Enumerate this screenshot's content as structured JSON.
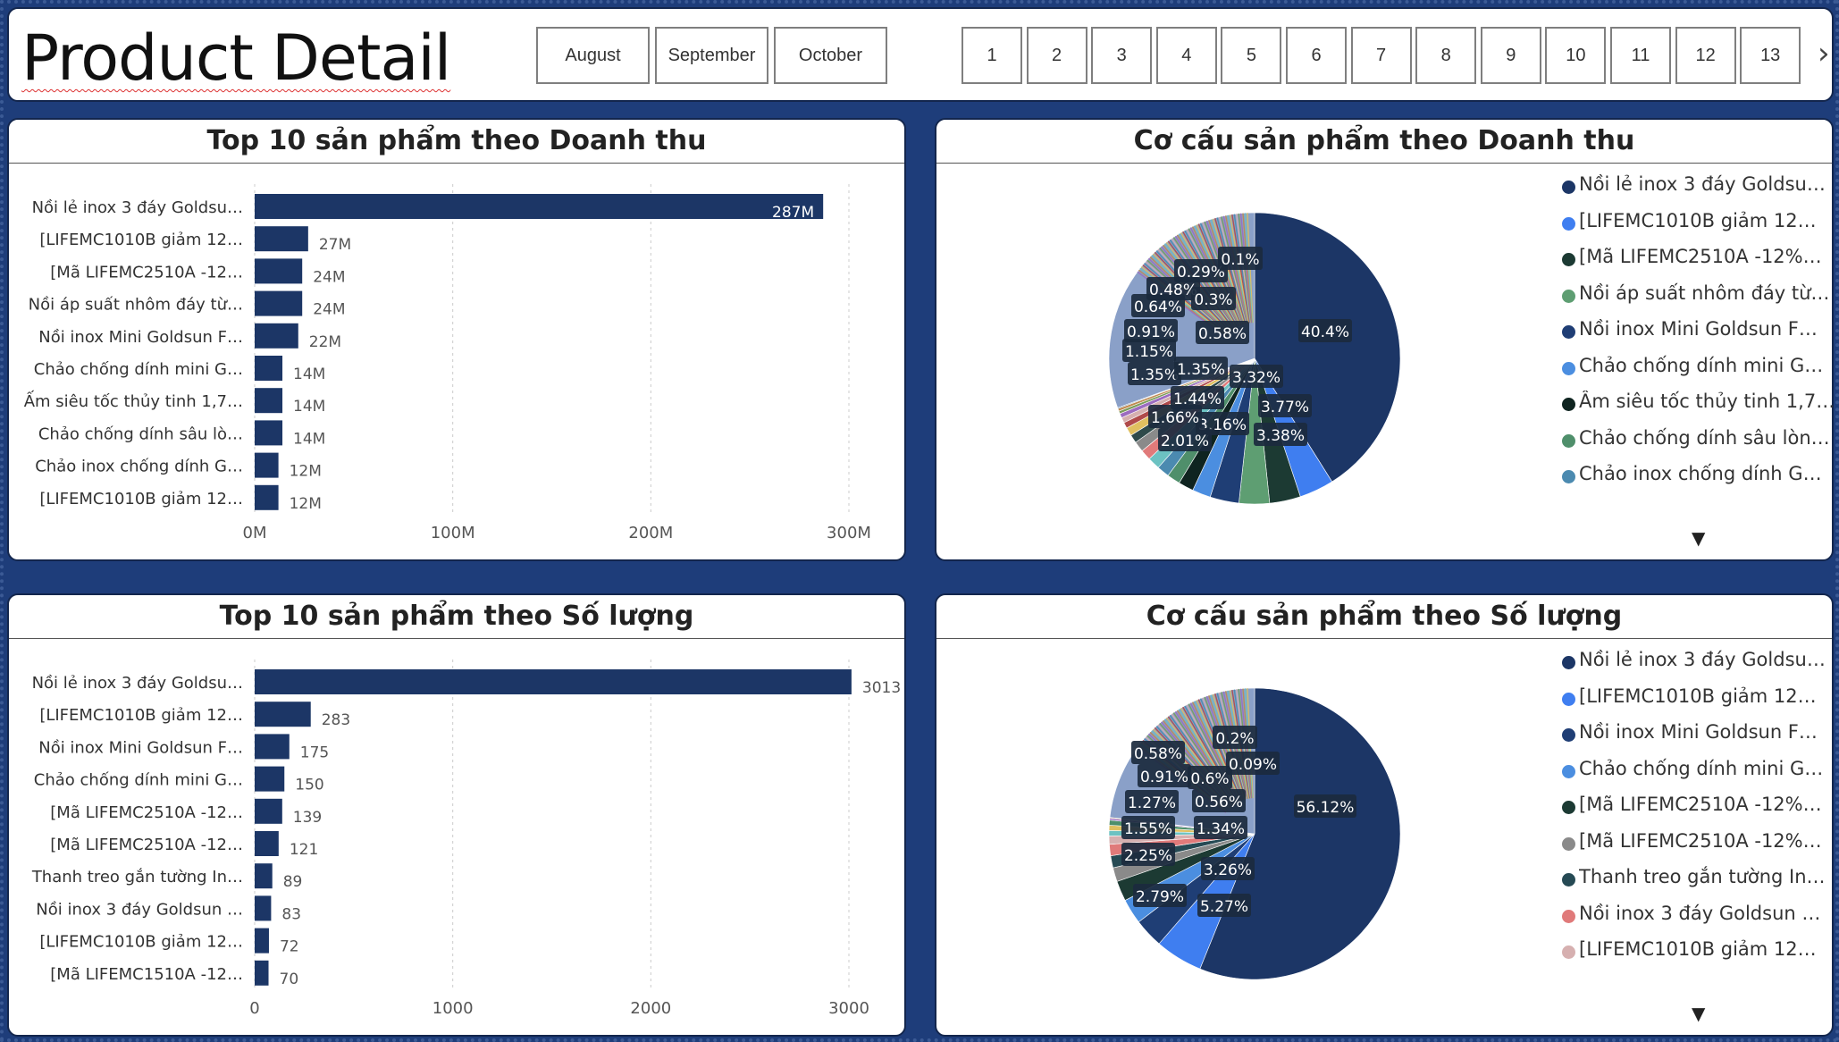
{
  "header": {
    "title": "Product Detail",
    "months": [
      "August",
      "September",
      "October"
    ],
    "days": [
      "1",
      "2",
      "3",
      "4",
      "5",
      "6",
      "7",
      "8",
      "9",
      "10",
      "11",
      "12",
      "13"
    ],
    "next_icon": "chevron-right-icon"
  },
  "colors": {
    "background": "#1e3d7a",
    "bar": "#1c3666",
    "panel_border": "#13264d"
  },
  "revenue_bar": {
    "title": "Top 10 sản phẩm theo Doanh thu",
    "chart_data": {
      "type": "bar",
      "orientation": "horizontal",
      "categories": [
        "Nồi lẻ inox 3 đáy Goldsu…",
        "[LIFEMC1010B giảm 12…",
        "[Mã LIFEMC2510A -12…",
        "Nồi áp suất nhôm đáy từ…",
        "Nồi inox Mini Goldsun F…",
        "Chảo chống dính mini G…",
        "Ấm siêu tốc thủy tinh 1,7…",
        "Chảo chống dính sâu lò…",
        "Chảo inox chống dính G…",
        "[LIFEMC1010B giảm 12…"
      ],
      "values": [
        287,
        27,
        24,
        24,
        22,
        14,
        14,
        14,
        12,
        12
      ],
      "value_labels": [
        "287M",
        "27M",
        "24M",
        "24M",
        "22M",
        "14M",
        "14M",
        "14M",
        "12M",
        "12M"
      ],
      "xticks": [
        "0M",
        "100M",
        "200M",
        "300M"
      ],
      "xlim": [
        0,
        300
      ],
      "grid": true
    }
  },
  "revenue_pie": {
    "title": "Cơ cấu sản phẩm theo Doanh thu",
    "chart_data": {
      "type": "pie",
      "slices": [
        {
          "label": "Nồi lẻ inox 3 đáy Goldsu…",
          "value": 40.4,
          "color": "#1c3666",
          "text": "40.4%"
        },
        {
          "label": "[LIFEMC1010B giảm 12…",
          "value": 3.77,
          "color": "#3f7ef0",
          "text": "3.77%"
        },
        {
          "label": "[Mã LIFEMC2510A -12%…",
          "value": 3.38,
          "color": "#1c3a33",
          "text": "3.38%"
        },
        {
          "label": "Nồi áp suất nhôm đáy từ…",
          "value": 3.32,
          "color": "#5e9e72",
          "text": "3.32%"
        },
        {
          "label": "Nồi inox Mini Goldsun F…",
          "value": 3.16,
          "color": "#1f3e75",
          "text": "3.16%"
        },
        {
          "label": "Chảo chống dính mini G…",
          "value": 2.01,
          "color": "#4b8ee0",
          "text": "2.01%"
        },
        {
          "label": "Ấm siêu tốc thủy tinh 1,7…",
          "value": 1.66,
          "color": "#0f2420",
          "text": "1.66%"
        },
        {
          "label": "Chảo chống dính sâu lòn…",
          "value": 1.44,
          "color": "#4f8f6b",
          "text": "1.44%"
        },
        {
          "label": "Chảo inox chống dính G…",
          "value": 1.35,
          "color": "#4b8ab0",
          "text": "1.35%"
        },
        {
          "label": "",
          "value": 1.35,
          "color": "#6cc2c2",
          "text": "1.35%"
        },
        {
          "label": "",
          "value": 1.15,
          "color": "#e07a7a",
          "text": "1.15%"
        },
        {
          "label": "",
          "value": 1.15,
          "color": "#8a8a8a",
          "text": "1.15%"
        },
        {
          "label": "",
          "value": 0.91,
          "color": "#2e4a4a",
          "text": "0.91%"
        },
        {
          "label": "",
          "value": 0.91,
          "color": "#e0c060",
          "text": "0.91%"
        },
        {
          "label": "",
          "value": 0.64,
          "color": "#b04a4a",
          "text": "0.64%"
        },
        {
          "label": "",
          "value": 0.58,
          "color": "#d6b0b0",
          "text": "0.58%"
        },
        {
          "label": "",
          "value": 0.48,
          "color": "#9c6cc0",
          "text": "0.48%"
        },
        {
          "label": "",
          "value": 0.3,
          "color": "#7a9c5a",
          "text": "0.3%"
        },
        {
          "label": "",
          "value": 0.29,
          "color": "#c08a50",
          "text": "0.29%"
        },
        {
          "label": "",
          "value": 0.1,
          "color": "#3a6a9a",
          "text": "0.1%"
        },
        {
          "label": "",
          "value": 30.0,
          "color": "#8aa0c8",
          "text": ""
        }
      ]
    }
  },
  "qty_bar": {
    "title": "Top 10 sản phẩm theo Số lượng",
    "chart_data": {
      "type": "bar",
      "orientation": "horizontal",
      "categories": [
        "Nồi lẻ inox 3 đáy Goldsu…",
        "[LIFEMC1010B giảm 12…",
        "Nồi inox Mini Goldsun F…",
        "Chảo chống dính mini G…",
        "[Mã LIFEMC2510A -12…",
        "[Mã LIFEMC2510A -12…",
        "Thanh treo gắn tường In…",
        "Nồi inox 3 đáy Goldsun …",
        "[LIFEMC1010B giảm 12…",
        "[Mã LIFEMC1510A -12…"
      ],
      "values": [
        3013,
        283,
        175,
        150,
        139,
        121,
        89,
        83,
        72,
        70
      ],
      "value_labels": [
        "3013",
        "283",
        "175",
        "150",
        "139",
        "121",
        "89",
        "83",
        "72",
        "70"
      ],
      "xticks": [
        "0",
        "1000",
        "2000",
        "3000"
      ],
      "xlim": [
        0,
        3000
      ],
      "grid": true
    }
  },
  "qty_pie": {
    "title": "Cơ cấu sản phẩm theo Số lượng",
    "chart_data": {
      "type": "pie",
      "slices": [
        {
          "label": "Nồi lẻ inox 3 đáy Goldsu…",
          "value": 56.12,
          "color": "#1c3666",
          "text": "56.12%"
        },
        {
          "label": "[LIFEMC1010B giảm 12…",
          "value": 5.27,
          "color": "#3f7ef0",
          "text": "5.27%"
        },
        {
          "label": "Nồi inox Mini Goldsun F…",
          "value": 3.26,
          "color": "#1f3e75",
          "text": "3.26%"
        },
        {
          "label": "Chảo chống dính mini G…",
          "value": 2.79,
          "color": "#4b8ee0",
          "text": "2.79%"
        },
        {
          "label": "[Mã LIFEMC2510A -12%…",
          "value": 2.25,
          "color": "#1c3a33",
          "text": "2.25%"
        },
        {
          "label": "[Mã LIFEMC2510A -12%…",
          "value": 1.55,
          "color": "#8a8a8a",
          "text": "1.55%"
        },
        {
          "label": "Thanh treo gắn tường In…",
          "value": 1.34,
          "color": "#264a54",
          "text": "1.34%"
        },
        {
          "label": "Nồi inox 3 đáy Goldsun …",
          "value": 1.27,
          "color": "#e07a7a",
          "text": "1.27%"
        },
        {
          "label": "[LIFEMC1010B giảm 12…",
          "value": 0.91,
          "color": "#d6b0b0",
          "text": "0.91%"
        },
        {
          "label": "",
          "value": 0.6,
          "color": "#6cc2c2",
          "text": "0.6%"
        },
        {
          "label": "",
          "value": 0.58,
          "color": "#e0c060",
          "text": "0.58%"
        },
        {
          "label": "",
          "value": 0.56,
          "color": "#4f8f6b",
          "text": "0.56%"
        },
        {
          "label": "",
          "value": 0.2,
          "color": "#9c6cc0",
          "text": "0.2%"
        },
        {
          "label": "",
          "value": 0.09,
          "color": "#c08a50",
          "text": "0.09%"
        },
        {
          "label": "",
          "value": 23.21,
          "color": "#8aa0c8",
          "text": ""
        }
      ]
    }
  }
}
